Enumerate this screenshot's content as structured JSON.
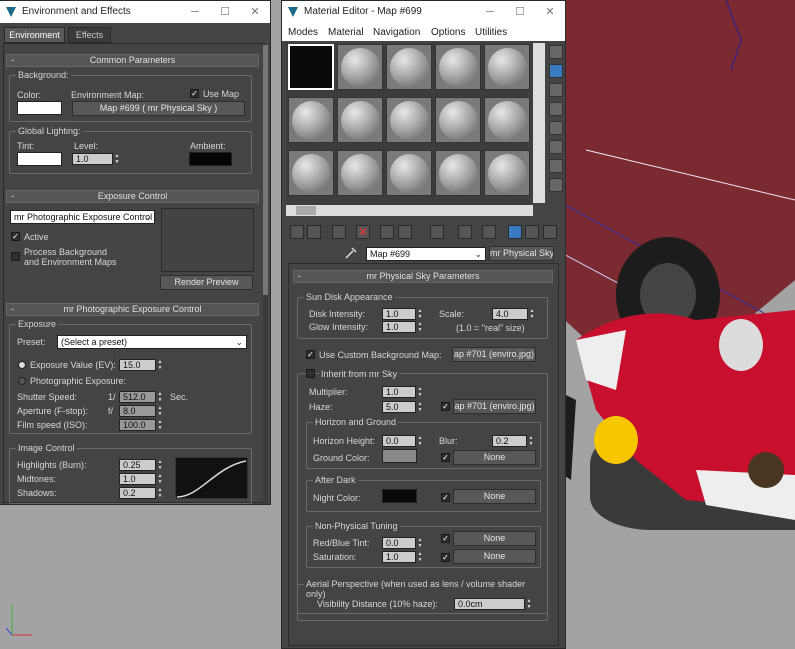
{
  "env": {
    "title": "Environment and Effects",
    "tabs": [
      "Environment",
      "Effects"
    ],
    "common": {
      "header": "Common Parameters",
      "background": "Background:",
      "color": "Color:",
      "env_map": "Environment Map:",
      "use_map": "Use Map",
      "map_button": "Map #699  ( mr Physical Sky )",
      "global_lighting": "Global Lighting:",
      "tint": "Tint:",
      "level": "Level:",
      "level_value": "1.0",
      "ambient": "Ambient:"
    },
    "exposure": {
      "header": "Exposure Control",
      "selected": "mr Photographic Exposure Control",
      "active": "Active",
      "process_bg": "Process Background",
      "process_bg2": "and Environment Maps",
      "render_preview": "Render Preview"
    },
    "mrpec": {
      "header": "mr Photographic Exposure Control",
      "group": "Exposure",
      "preset": "Preset:",
      "preset_value": "(Select a preset)",
      "ev": "Exposure Value (EV):",
      "ev_value": "15.0",
      "photo": "Photographic Exposure:",
      "shutter": "Shutter Speed:",
      "shutter_prefix": "1/",
      "shutter_value": "512.0",
      "shutter_unit": "Sec.",
      "aperture": "Aperture (F-stop):",
      "aperture_prefix": "f/",
      "aperture_value": "8.0",
      "film": "Film speed (ISO):",
      "film_value": "100.0"
    },
    "image_control": {
      "group": "Image Control",
      "highlights": "Highlights (Burn):",
      "highlights_value": "0.25",
      "midtones": "Midtones:",
      "midtones_value": "1.0",
      "shadows": "Shadows:",
      "shadows_value": "0.2"
    }
  },
  "mat": {
    "title": "Material Editor - Map #699",
    "menus": [
      "Modes",
      "Material",
      "Navigation",
      "Options",
      "Utilities"
    ],
    "map_name": "Map #699",
    "map_type": "mr Physical Sky",
    "rollout": "mr Physical Sky Parameters",
    "sun": {
      "group": "Sun Disk Appearance",
      "disk": "Disk Intensity:",
      "disk_value": "1.0",
      "glow": "Glow Intensity:",
      "glow_value": "1.0",
      "scale": "Scale:",
      "scale_value": "4.0",
      "note": "(1.0 = \"real\" size)"
    },
    "custom_bg": {
      "label": "Use Custom Background Map:",
      "map": "ap #701 (enviro.jpg)"
    },
    "inherit": {
      "label": "Inherit from mr Sky",
      "multiplier": "Multiplier:",
      "multiplier_value": "1.0",
      "haze": "Haze:",
      "haze_value": "5.0",
      "haze_map": "ap #701 (enviro.jpg)"
    },
    "horizon": {
      "group": "Horizon and Ground",
      "height": "Horizon Height:",
      "height_value": "0.0",
      "blur": "Blur:",
      "blur_value": "0.2",
      "ground": "Ground Color:",
      "none": "None"
    },
    "after_dark": {
      "group": "After Dark",
      "night": "Night Color:",
      "none": "None"
    },
    "tuning": {
      "group": "Non-Physical Tuning",
      "redblue": "Red/Blue Tint:",
      "redblue_value": "0.0",
      "saturation": "Saturation:",
      "saturation_value": "1.0",
      "none": "None"
    },
    "aerial": {
      "group": "Aerial Perspective (when used as lens / volume shader only)",
      "visibility": "Visibility Distance (10% haze):",
      "visibility_value": "0.0cm"
    }
  },
  "colors": {
    "panel": "#444444",
    "carpet": "#7a2a30",
    "car_red": "#c8102e"
  }
}
